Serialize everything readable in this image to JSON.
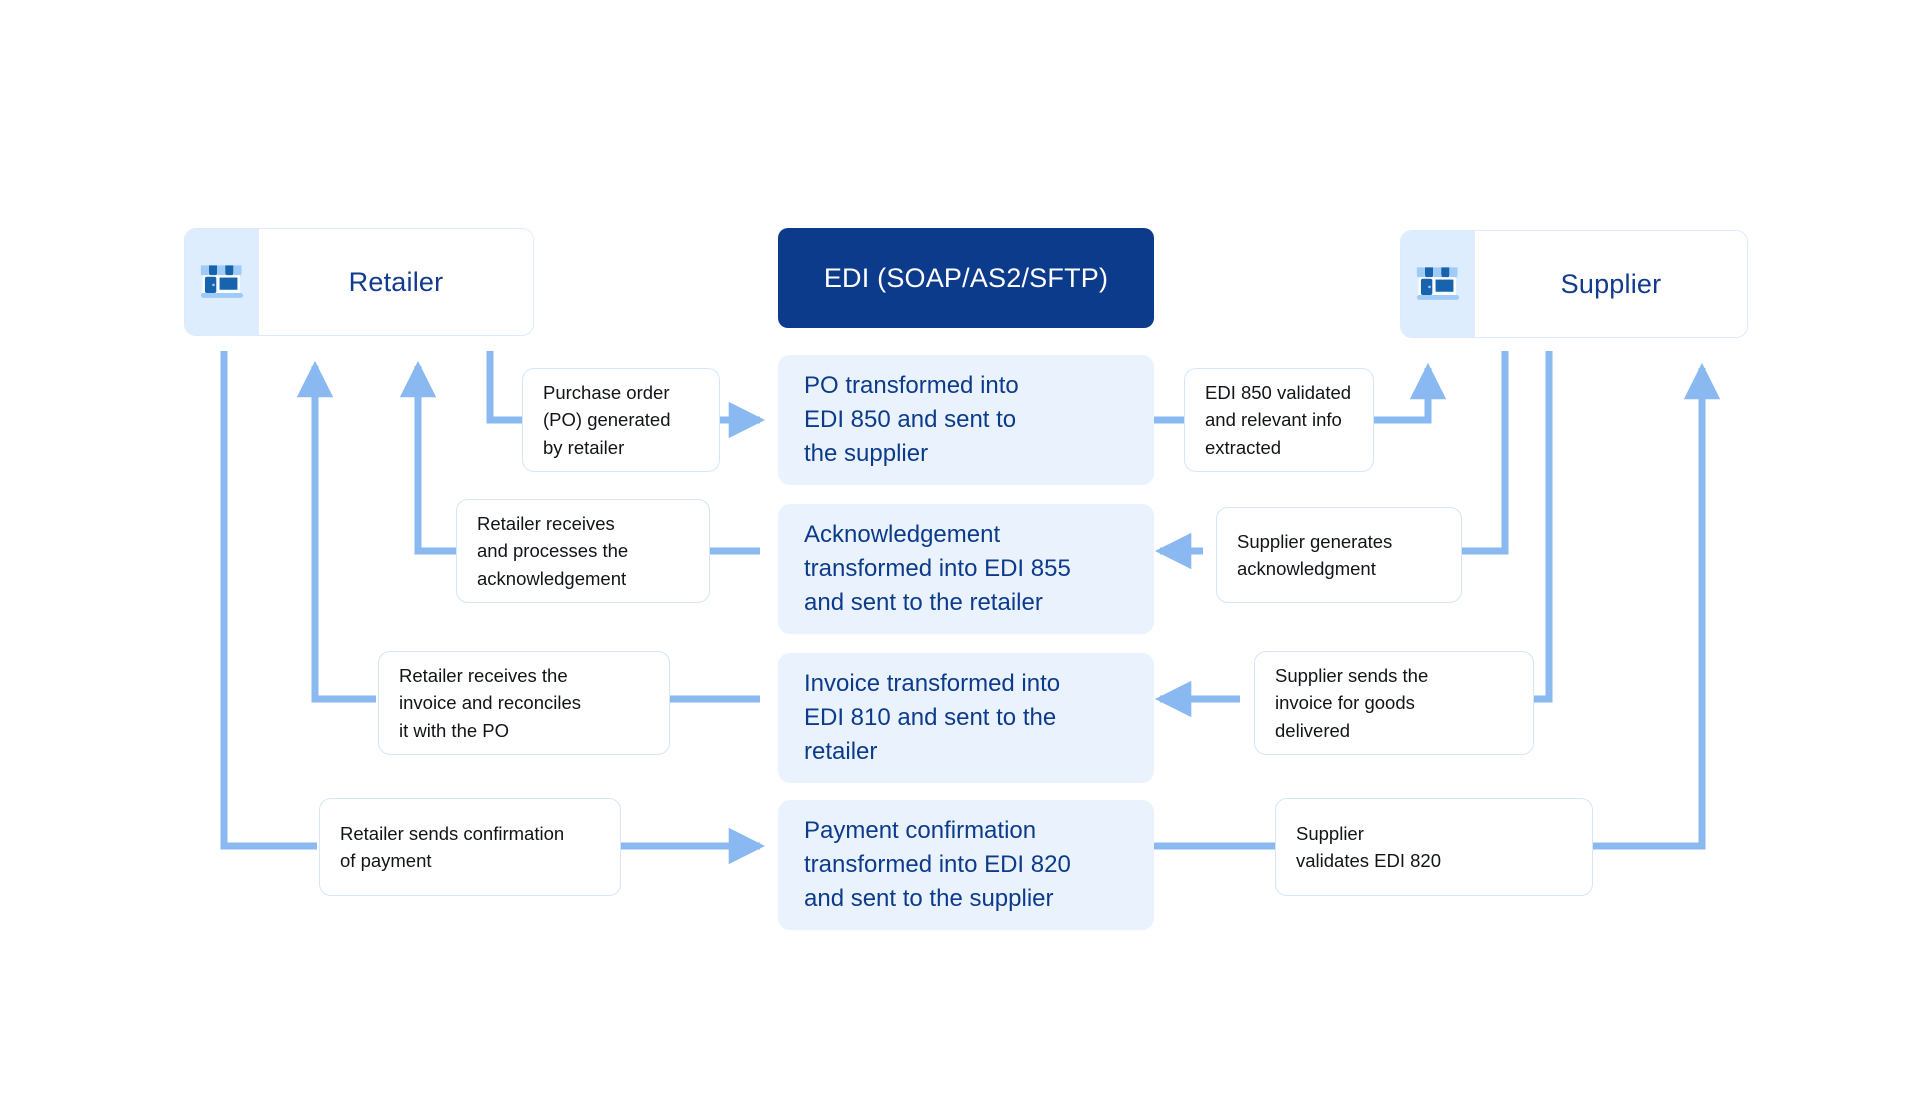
{
  "diagram": {
    "title": "EDI (SOAP/AS2/SFTP) retailer-supplier transaction flow",
    "colors": {
      "accent_navy": "#0d3b8c",
      "center_box_bg": "#eaf3fd",
      "side_box_border": "#d4e6fb",
      "wire": "#8ab8f0",
      "icon_pane_bg": "#ddedfd",
      "page_bg": "#ffffff"
    }
  },
  "parties": {
    "retailer": {
      "label": "Retailer",
      "icon": "storefront-icon"
    },
    "supplier": {
      "label": "Supplier",
      "icon": "storefront-icon"
    }
  },
  "header": {
    "label": "EDI (SOAP/AS2/SFTP)"
  },
  "rows": [
    {
      "id": "po-850",
      "left_note": "Purchase order\n(PO) generated\nby retailer",
      "center": "PO transformed into\nEDI 850 and sent to\nthe supplier",
      "right_note": "EDI 850 validated\nand relevant info\nextracted",
      "direction": "retailer-to-supplier"
    },
    {
      "id": "ack-855",
      "left_note": "Retailer receives\nand processes the\nacknowledgement",
      "center": "Acknowledgement\ntransformed into EDI 855\nand sent to the retailer",
      "right_note": "Supplier generates\nacknowledgment",
      "direction": "supplier-to-retailer"
    },
    {
      "id": "invoice-810",
      "left_note": "Retailer receives the\ninvoice and reconciles\nit with the PO",
      "center": "Invoice transformed into\nEDI 810 and sent to the\nretailer",
      "right_note": "Supplier sends the\ninvoice for goods\ndelivered",
      "direction": "supplier-to-retailer"
    },
    {
      "id": "payment-820",
      "left_note": "Retailer sends confirmation\nof payment",
      "center": "Payment confirmation\ntransformed into EDI 820\nand sent to the supplier",
      "right_note": "Supplier\nvalidates EDI 820",
      "direction": "retailer-to-supplier"
    }
  ]
}
